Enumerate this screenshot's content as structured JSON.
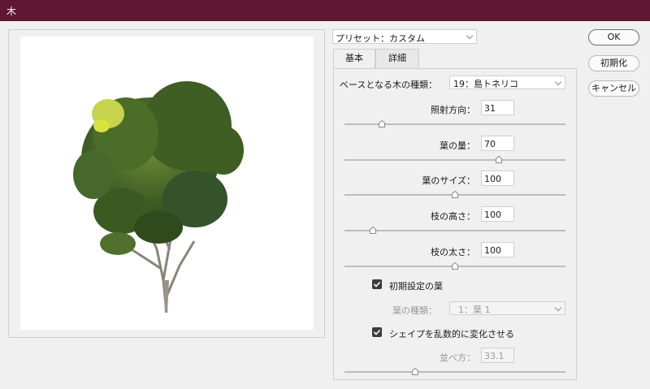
{
  "window": {
    "title": "木"
  },
  "preset": {
    "value": "プリセット：カスタム"
  },
  "tabs": [
    {
      "label": "基本"
    },
    {
      "label": "詳細"
    }
  ],
  "fields": {
    "base_tree": {
      "label": "ベースとなる木の種類：",
      "value": "19：島トネリコ"
    },
    "light_direction": {
      "label": "照射方向：",
      "value": "31",
      "slider_fraction": 0.17
    },
    "leaf_amount": {
      "label": "葉の量：",
      "value": "70",
      "slider_fraction": 0.7
    },
    "leaf_size": {
      "label": "葉のサイズ：",
      "value": "100",
      "slider_fraction": 0.5
    },
    "branch_height": {
      "label": "枝の高さ：",
      "value": "100",
      "slider_fraction": 0.13
    },
    "branch_thickness": {
      "label": "枝の太さ：",
      "value": "100",
      "slider_fraction": 0.5
    },
    "default_leaves": {
      "label": "初期設定の葉",
      "checked": true
    },
    "leaf_type": {
      "label": "葉の種類：",
      "value": "1：葉 1"
    },
    "randomize_shape": {
      "label": "シェイプを乱数的に変化させる",
      "checked": true
    },
    "arrangement": {
      "label": "並べ方：",
      "value": "33.1",
      "slider_fraction": 0.32
    }
  },
  "buttons": {
    "ok": "OK",
    "reset": "初期化",
    "cancel": "キャンセル"
  },
  "icons": {
    "checkmark": "checkmark-icon",
    "dropdown": "chevron-down-icon",
    "preview": "tree-illustration"
  }
}
